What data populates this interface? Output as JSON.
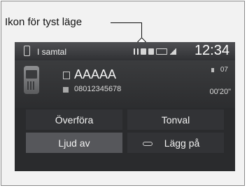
{
  "callout": {
    "label": "Ikon för tyst läge"
  },
  "statusbar": {
    "title": "I samtal",
    "clock": "12:34"
  },
  "call": {
    "name": "AAAAA",
    "number": "08012345678",
    "volume": "07",
    "duration": "00'20\""
  },
  "buttons": {
    "transfer": "Överföra",
    "dial_tone": "Tonval",
    "mute": "Ljud av",
    "hang_up": "Lägg på"
  },
  "icons": {
    "status_phone": "phone-icon",
    "mute": "mute-icon",
    "bluetooth": "bluetooth-icon",
    "battery": "battery-icon",
    "signal": "signal-icon",
    "handset": "mobile-phone-icon",
    "hang_up": "hang-up-icon"
  }
}
